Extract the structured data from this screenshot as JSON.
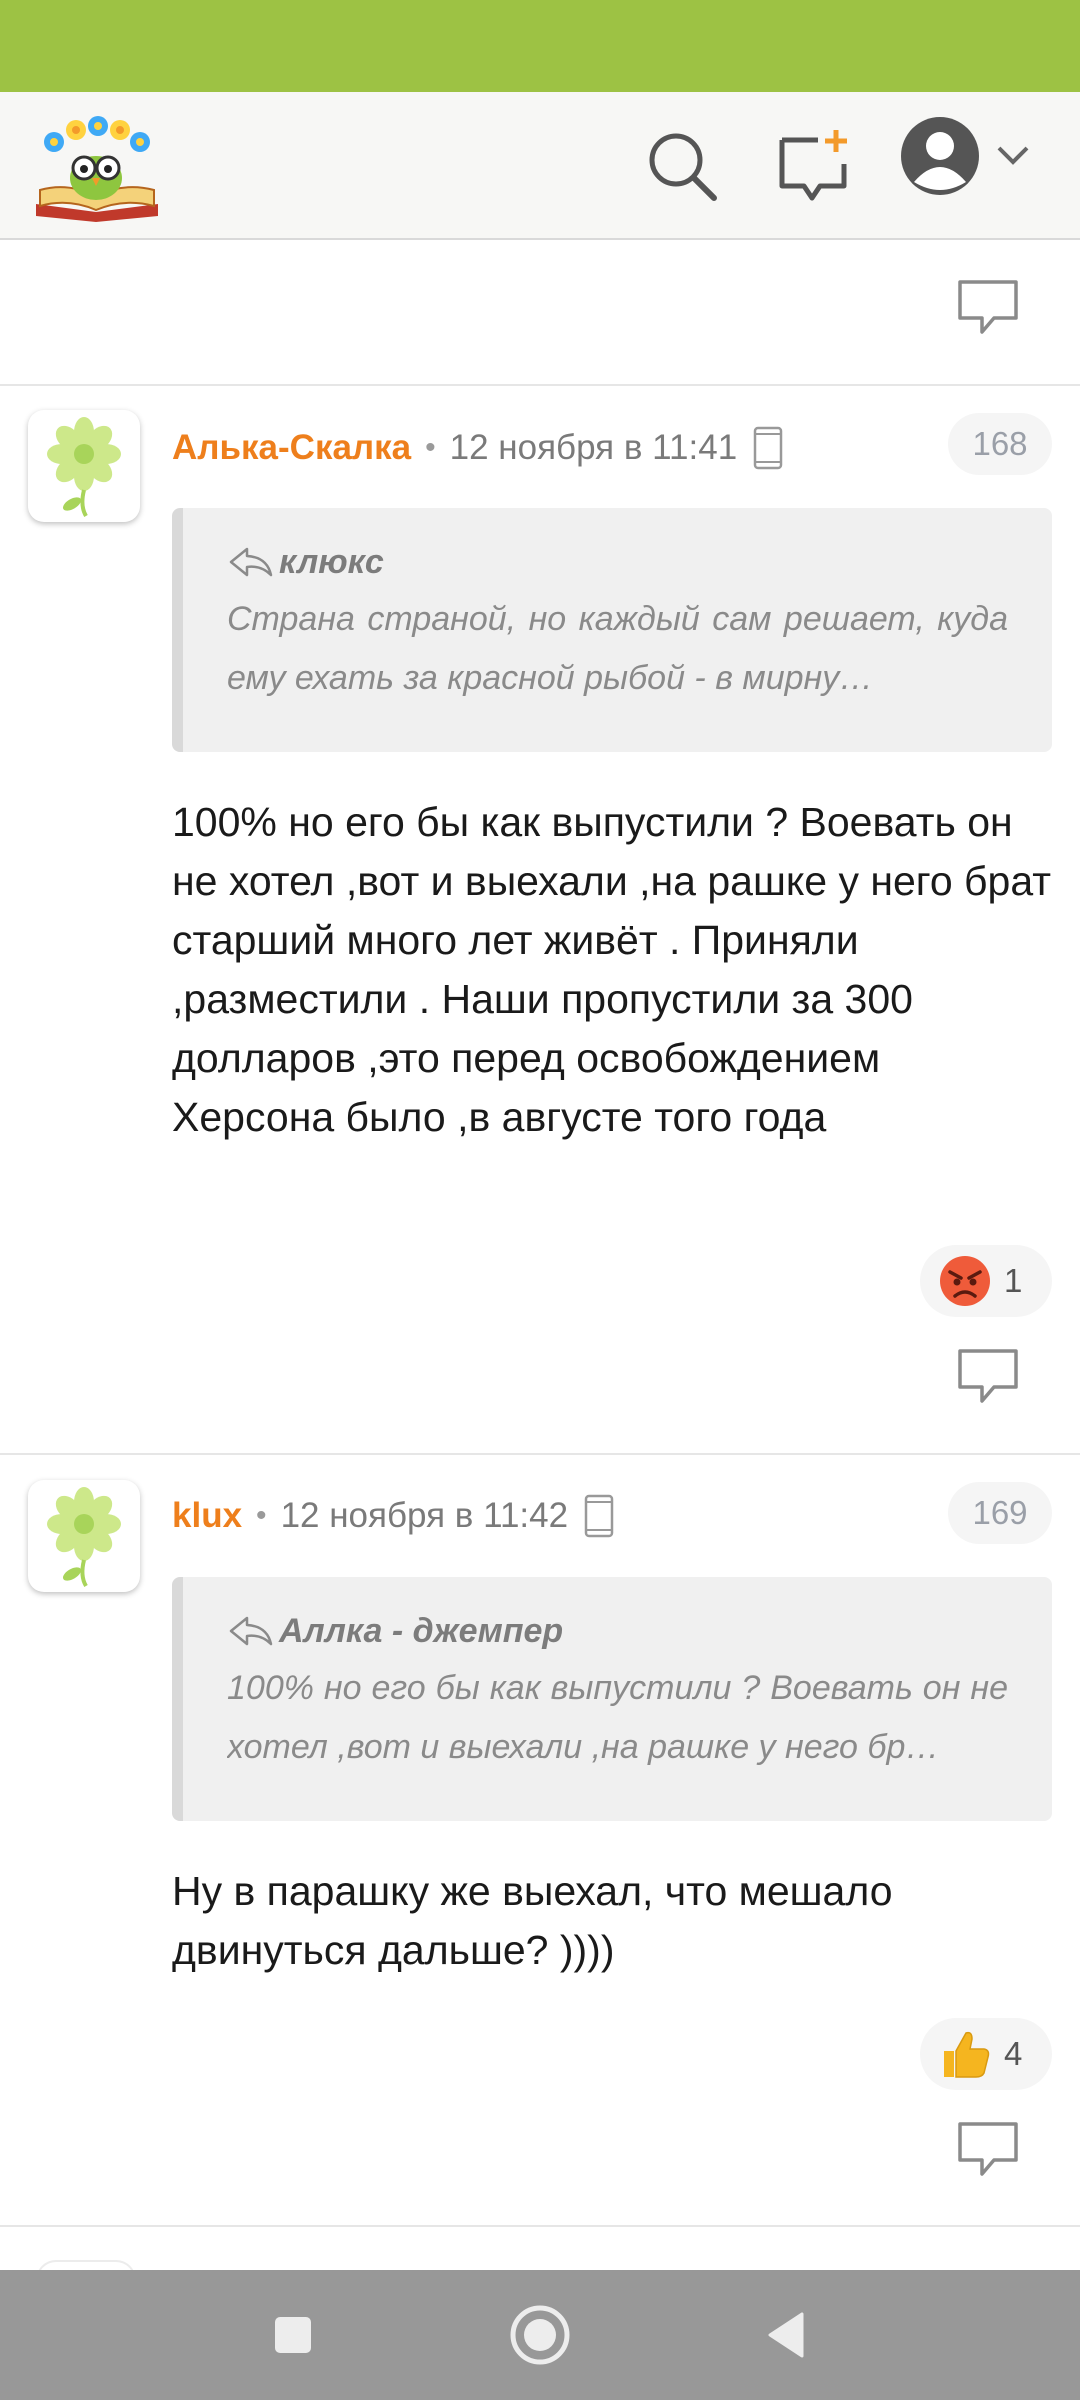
{
  "colors": {
    "status_bar": "#9dc244",
    "author": "#ee7f1c",
    "notification_badge": "#f39a2a",
    "nav_bar": "#989898"
  },
  "header": {
    "logo_icon": "owl-book-logo-icon",
    "search_icon": "search-icon",
    "new_post_icon": "new-message-icon",
    "profile_icon": "user-avatar-icon",
    "dropdown_icon": "chevron-down-icon"
  },
  "comments": [
    {
      "author": "Алька-Скалка",
      "separator": "•",
      "time": "12 ноября в 11:41",
      "device_icon": "mobile-phone-icon",
      "number": "168",
      "quote": {
        "author": "клюкс",
        "text": "Страна страной, но каждый сам решает, куда ему ехать за красной рыбой - в мирну…"
      },
      "text": "100% но его бы как выпустили ? Воевать он не хотел ,вот и выехали ,на рашке у него брат старший много лет живёт . Приняли ,разместили . Наши пропустили за 300 долларов ,это перед освобождением Херсона было ,в августе того года",
      "reaction": {
        "icon": "angry-face-icon",
        "count": "1"
      }
    },
    {
      "author": "klux",
      "separator": "•",
      "time": "12 ноября в 11:42",
      "device_icon": "mobile-phone-icon",
      "number": "169",
      "quote": {
        "author": "Аллка - джемпер",
        "text": "100% но его бы как выпустили ? Воевать он не хотел ,вот и выехали ,на рашке у него бр…"
      },
      "text": "Ну в парашку же выехал, что мешало двинуться дальше? ))))",
      "reaction": {
        "icon": "thumbs-up-icon",
        "count": "4"
      }
    }
  ],
  "nav": {
    "recents_icon": "square-icon",
    "home_icon": "circle-icon",
    "back_icon": "triangle-back-icon"
  }
}
